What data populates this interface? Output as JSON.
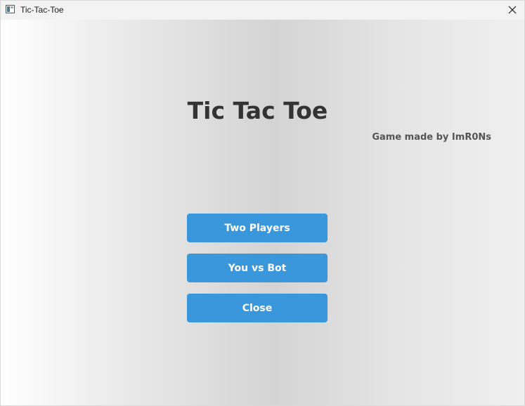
{
  "window": {
    "title": "Tic-Tac-Toe",
    "app_icon": "window-app-icon",
    "close_icon": "close-icon"
  },
  "main": {
    "heading": "Tic Tac Toe",
    "credit": "Game made by ImR0Ns",
    "buttons": [
      {
        "label": "Two Players"
      },
      {
        "label": "You vs Bot"
      },
      {
        "label": "Close"
      }
    ]
  },
  "colors": {
    "button_bg": "#3a97dc",
    "button_text": "#ffffff",
    "heading_text": "#333333",
    "credit_text": "#555555"
  }
}
